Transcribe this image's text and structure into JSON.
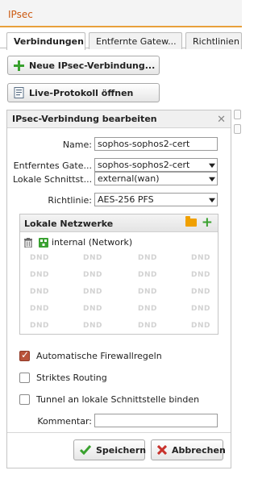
{
  "window": {
    "title": "IPsec"
  },
  "tabs": [
    {
      "label": "Verbindungen",
      "active": true
    },
    {
      "label": "Entfernte Gatew..."
    },
    {
      "label": "Richtlinien"
    }
  ],
  "toolbar": {
    "new_label": "Neue IPsec-Verbindung...",
    "log_label": "Live-Protokoll öffnen"
  },
  "panel": {
    "title": "IPsec-Verbindung bearbeiten",
    "close_icon": "close-icon",
    "form": {
      "name_label": "Name:",
      "name_value": "sophos-sophos2-cert",
      "gateway_label": "Entferntes Gate...",
      "gateway_value": "sophos-sophos2-cert",
      "interface_label": "Lokale Schnittst...",
      "interface_value": "external(wan)",
      "policy_label": "Richtlinie:",
      "policy_value": "AES-256 PFS"
    },
    "networks": {
      "title": "Lokale Netzwerke",
      "items": [
        {
          "label": "internal (Network)"
        }
      ],
      "dnd": "DND"
    },
    "options": {
      "auto_firewall": {
        "label": "Automatische Firewallregeln",
        "checked": true
      },
      "strict_routing": {
        "label": "Striktes Routing",
        "checked": false
      },
      "bind_tunnel": {
        "label": "Tunnel an lokale Schnittstelle binden",
        "checked": false
      }
    },
    "comment": {
      "label": "Kommentar:",
      "value": ""
    },
    "save_label": "Speichern",
    "cancel_label": "Abbrechen"
  },
  "colors": {
    "accent": "#e8a03a",
    "title": "#cc5a11",
    "green": "#39a12e",
    "red": "#c8312b"
  }
}
